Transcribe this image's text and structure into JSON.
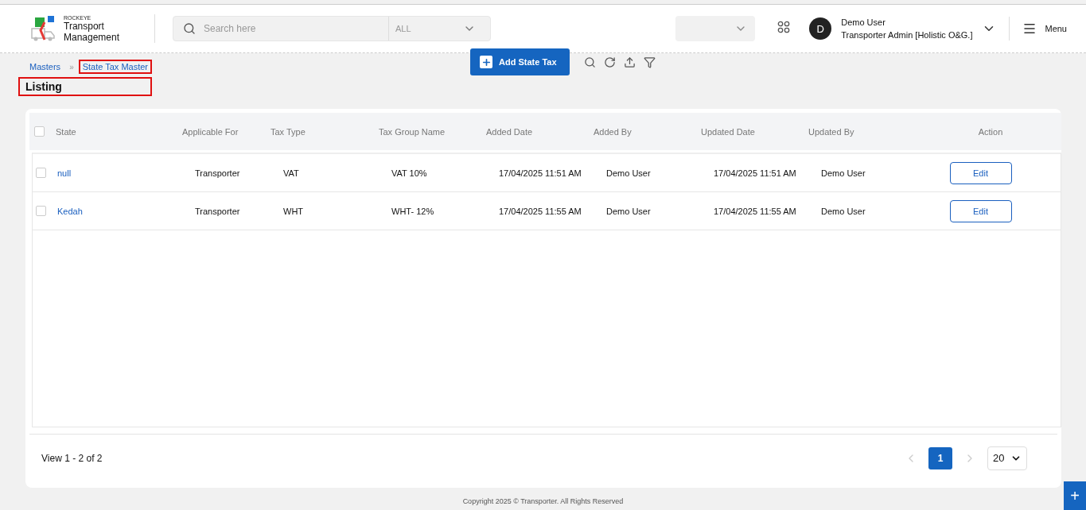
{
  "logo": {
    "brand": "ROCKEYE",
    "title": "Transport Management"
  },
  "search": {
    "placeholder": "Search here",
    "scope": "ALL"
  },
  "user": {
    "initial": "D",
    "name": "Demo User",
    "role": "Transporter Admin [Holistic O&G.]"
  },
  "menu_label": "Menu",
  "breadcrumb_separator": "»",
  "breadcrumbs": [
    {
      "label": "Masters",
      "highlighted": false
    },
    {
      "label": "State Tax Master",
      "highlighted": true
    }
  ],
  "page_title": {
    "label": "Listing",
    "highlighted": true
  },
  "add_button": "Add State Tax",
  "table": {
    "select_all_checked": false,
    "columns": [
      "State",
      "Applicable For",
      "Tax Type",
      "Tax Group Name",
      "Added Date",
      "Added By",
      "Updated Date",
      "Updated By",
      "Action"
    ],
    "rows": [
      {
        "checked": false,
        "cells": [
          "null",
          "Transporter",
          "VAT",
          "VAT 10%",
          "17/04/2025 11:51 AM",
          "Demo User",
          "17/04/2025 11:51 AM",
          "Demo User"
        ],
        "action": "Edit"
      },
      {
        "checked": false,
        "cells": [
          "Kedah",
          "Transporter",
          "WHT",
          "WHT- 12%",
          "17/04/2025 11:55 AM",
          "Demo User",
          "17/04/2025 11:55 AM",
          "Demo User"
        ],
        "action": "Edit"
      }
    ]
  },
  "pagination": {
    "summary": "View 1 - 2 of 2",
    "pages": [
      {
        "label": "1",
        "selected": true
      }
    ],
    "page_size": "20"
  },
  "footer": "Copyright 2025 © Transporter. All Rights Reserved",
  "fab": "+"
}
